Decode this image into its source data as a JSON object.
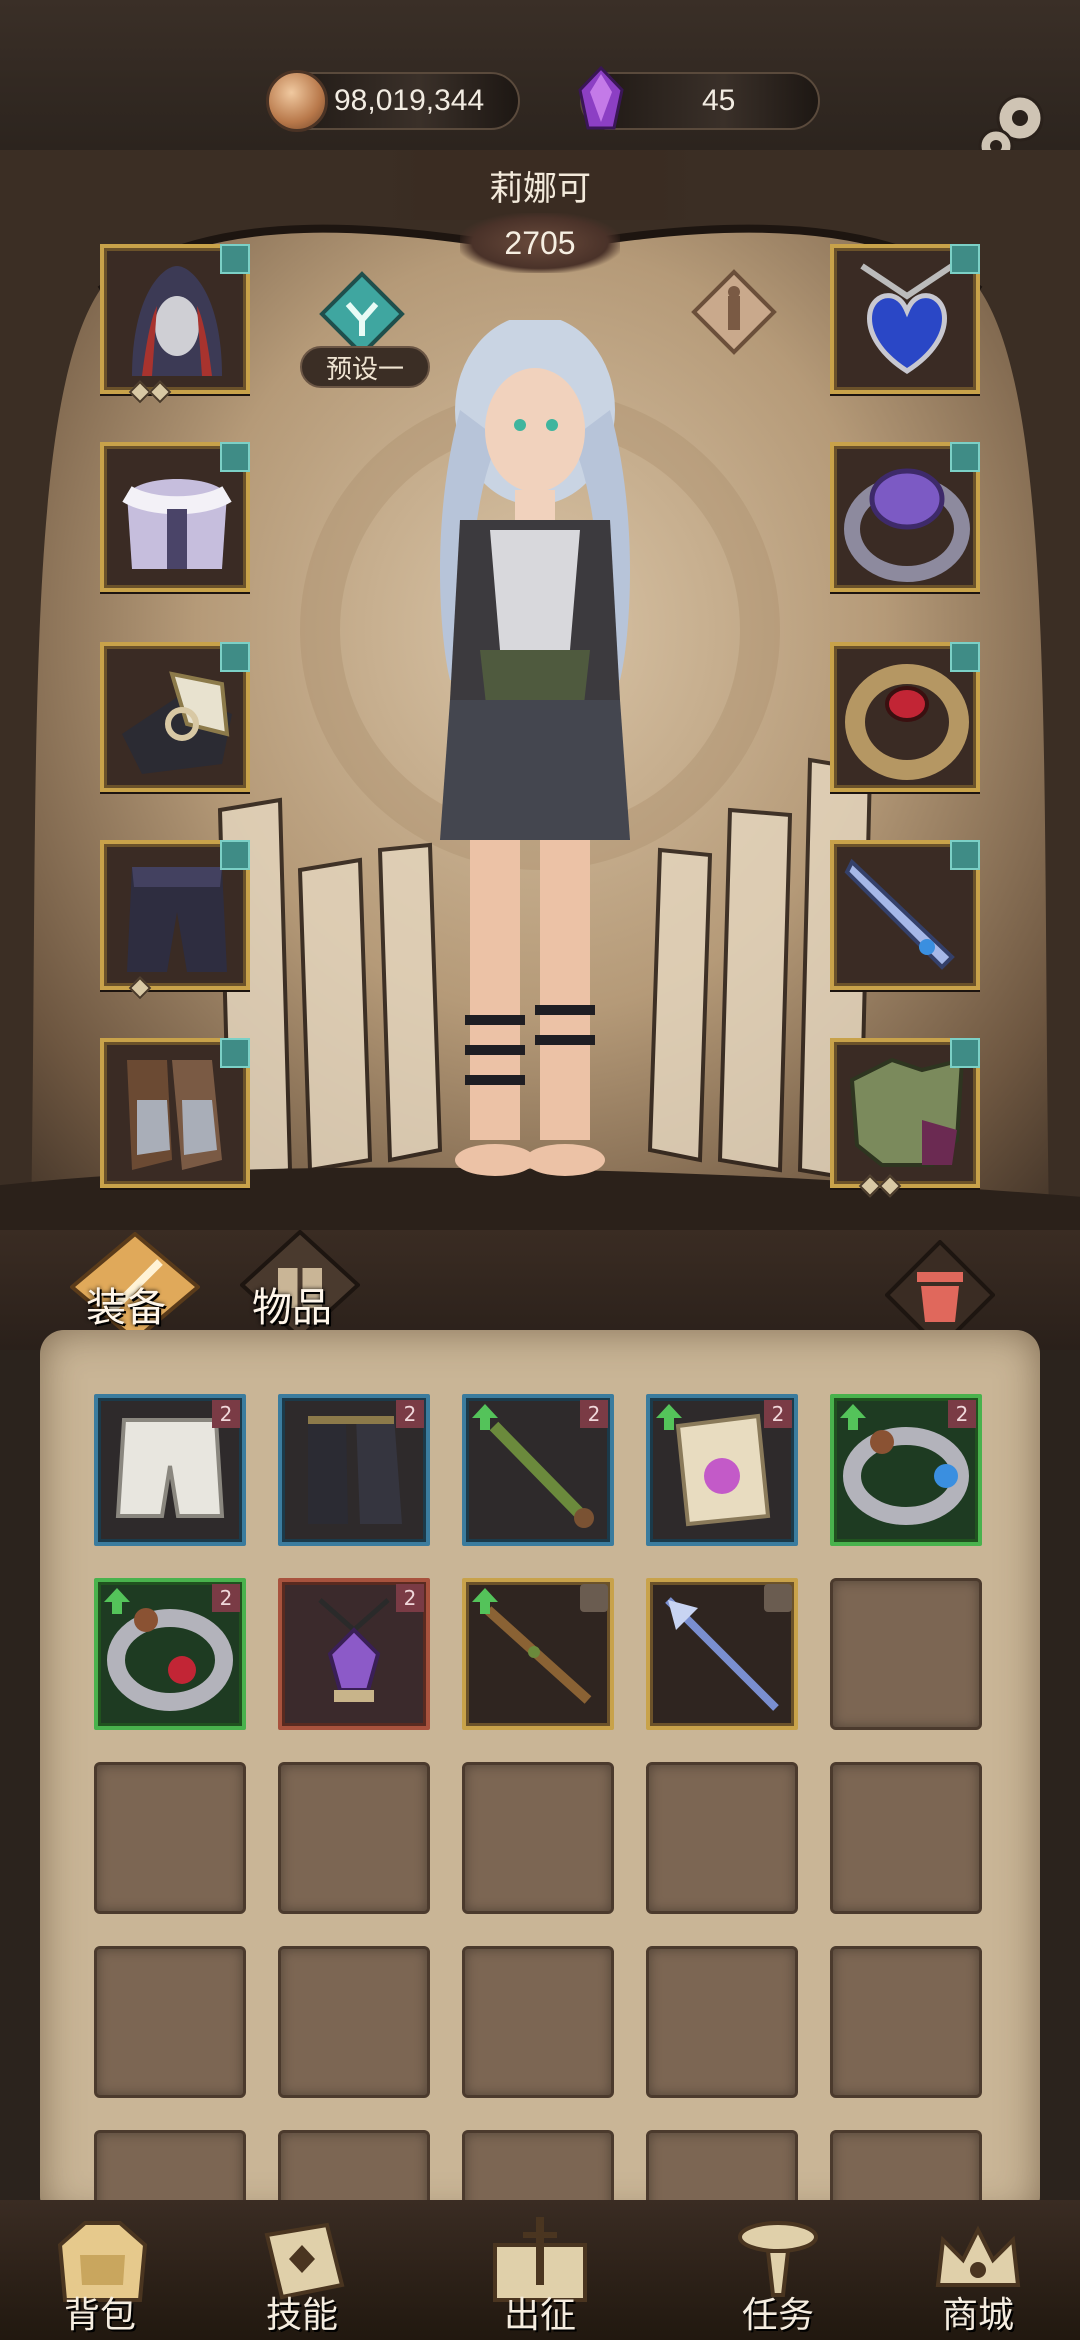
{
  "currency": {
    "gold": "98,019,344",
    "gold_icon": "gold-coin-icon",
    "gems": "45",
    "gem_icon": "purple-crystal-icon"
  },
  "character": {
    "name": "莉娜可",
    "power": "2705",
    "preset_label": "预设一"
  },
  "equipment_slots": {
    "left": [
      "hood-helmet",
      "fur-coat",
      "armored-gloves",
      "leather-pants",
      "armored-boots"
    ],
    "right": [
      "blue-heart-amulet",
      "purple-gem-ring",
      "red-gem-ring",
      "ice-sword",
      "green-beast-cloak"
    ]
  },
  "tabs": {
    "equipment": "装备",
    "items": "物品"
  },
  "inventory": {
    "row1": [
      {
        "icon": "white-shorts-icon",
        "quality": "blue",
        "badge": "2",
        "upgrade": false
      },
      {
        "icon": "black-boots-icon",
        "quality": "blue",
        "badge": "2",
        "upgrade": false
      },
      {
        "icon": "wooden-staff-icon",
        "quality": "blue",
        "badge": "2",
        "upgrade": true
      },
      {
        "icon": "scroll-potion-icon",
        "quality": "blue",
        "badge": "2",
        "upgrade": true
      },
      {
        "icon": "twin-gem-ring-icon",
        "quality": "green",
        "badge": "2",
        "upgrade": true
      }
    ],
    "row2": [
      {
        "icon": "red-eye-ring-icon",
        "quality": "green",
        "badge": "2",
        "upgrade": true
      },
      {
        "icon": "purple-gem-amulet-icon",
        "quality": "red",
        "badge": "2",
        "upgrade": false
      },
      {
        "icon": "thorn-staff-icon",
        "quality": "gold",
        "badge": "lock",
        "upgrade": true
      },
      {
        "icon": "ice-spear-icon",
        "quality": "gold",
        "badge": "lock",
        "upgrade": false
      }
    ]
  },
  "nav": {
    "bag": "背包",
    "skills": "技能",
    "expedition": "出征",
    "tasks": "任务",
    "shop": "商城"
  },
  "colors": {
    "slot_border_gold": "#c8a24a",
    "slot_badge_teal": "#3f8c86",
    "quality_blue": "#3b7c9e",
    "quality_green": "#49b24d",
    "quality_red": "#a8523d",
    "trash_red": "#e0685c"
  }
}
